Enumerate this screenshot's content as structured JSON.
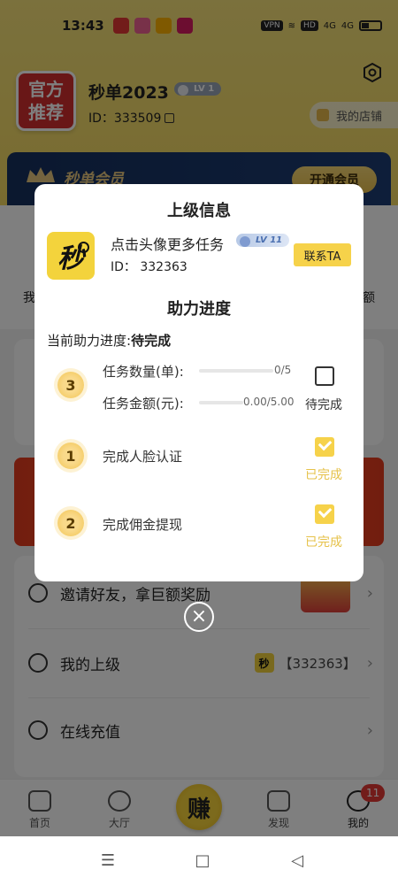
{
  "status_bar": {
    "time": "13:43",
    "vpn": "VPN",
    "hd": "HD",
    "signal1": "4G",
    "signal2": "4G",
    "battery": ""
  },
  "profile": {
    "badge_text": "官方推荐",
    "name": "秒单2023",
    "level": "LV 1",
    "id_label": "ID：",
    "id_value": "333509",
    "my_shop": "我的店铺"
  },
  "vip": {
    "title": "秒单会员",
    "open_button": "开通会员"
  },
  "side_labels": {
    "left": "我",
    "right": "额"
  },
  "menu": {
    "invite": "邀请好友，拿巨额奖励",
    "superior": "我的上级",
    "superior_id": "【332363】",
    "recharge": "在线充值"
  },
  "tabbar": {
    "home": "首页",
    "hall": "大厅",
    "earn": "赚",
    "discover": "发现",
    "mine": "我的",
    "badge": "11"
  },
  "dialog": {
    "title": "上级信息",
    "superior_logo": "秒",
    "superior_name": "点击头像更多任务",
    "superior_level": "LV 11",
    "superior_id": "ID：  332363",
    "contact_button": "联系TA",
    "section_title": "助力进度",
    "progress_label": "当前助力进度:",
    "progress_value": "待完成",
    "tasks": [
      {
        "number": "3",
        "label_qty": "任务数量(单):",
        "qty_value": "0/5",
        "qty_progress": 0,
        "label_amount": "任务金额(元):",
        "amount_value": "0.00/5.00",
        "amount_progress": 0,
        "status": "待完成",
        "completed": false
      },
      {
        "number": "1",
        "label": "完成人脸认证",
        "status": "已完成",
        "completed": true
      },
      {
        "number": "2",
        "label": "完成佣金提现",
        "status": "已完成",
        "completed": true
      }
    ],
    "close_icon": "×"
  },
  "colors": {
    "accent_yellow": "#f6d24a",
    "complete_text": "#e6c24a",
    "vip_navy": "#1c3c74"
  }
}
